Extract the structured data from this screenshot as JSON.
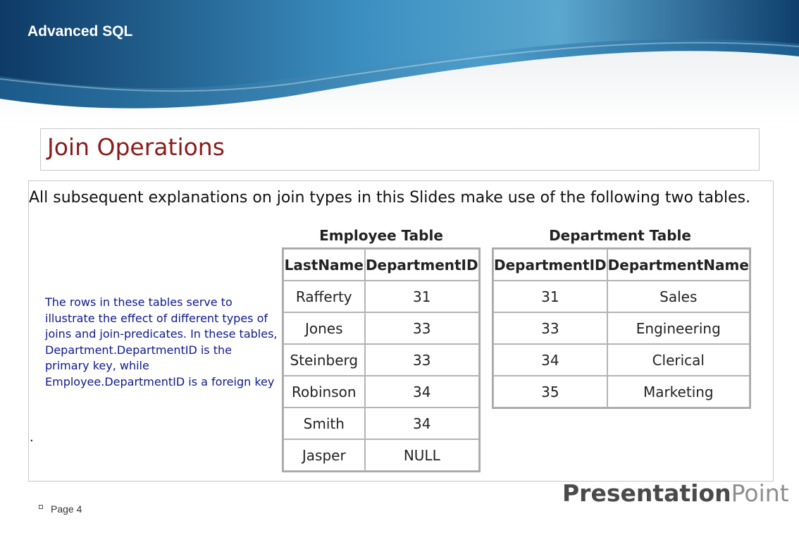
{
  "header": {
    "title": "Advanced SQL"
  },
  "slide": {
    "title": "Join Operations",
    "intro": "All subsequent explanations on join types in this Slides  make use of the following two tables.",
    "note": "The rows in these tables serve to illustrate the effect of different types of joins and join-predicates. In these tables, Department.DepartmentID is the primary key, while Employee.DepartmentID is a foreign key",
    "stray_mark": "."
  },
  "employee_table": {
    "caption": "Employee Table",
    "columns": [
      "LastName",
      "DepartmentID"
    ],
    "rows": [
      [
        "Rafferty",
        "31"
      ],
      [
        "Jones",
        "33"
      ],
      [
        "Steinberg",
        "33"
      ],
      [
        "Robinson",
        "34"
      ],
      [
        "Smith",
        "34"
      ],
      [
        "Jasper",
        "NULL"
      ]
    ]
  },
  "department_table": {
    "caption": "Department Table",
    "columns": [
      "DepartmentID",
      "DepartmentName"
    ],
    "rows": [
      [
        "31",
        "Sales"
      ],
      [
        "33",
        "Engineering"
      ],
      [
        "34",
        "Clerical"
      ],
      [
        "35",
        "Marketing"
      ]
    ]
  },
  "branding": {
    "part1": "Presentation",
    "part2": "Point"
  },
  "footer": {
    "page_label": "Page 4"
  },
  "colors": {
    "header_dark": "#0f3f6c",
    "header_light": "#5aa7cf",
    "title_color": "#8b1a1a",
    "note_color": "#0d1a8c"
  }
}
